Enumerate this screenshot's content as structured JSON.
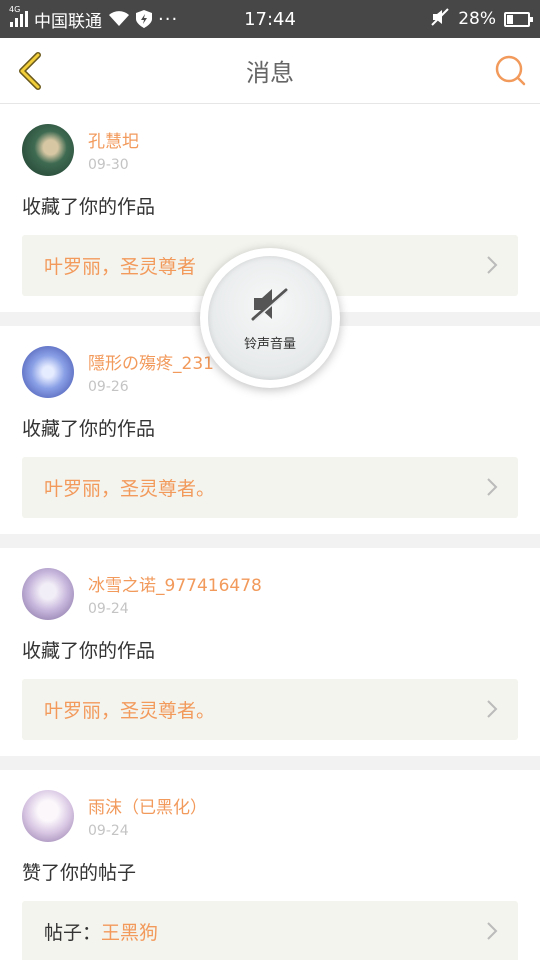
{
  "status_bar": {
    "network_tag": "4G",
    "carrier": "中国联通",
    "dots": "···",
    "time": "17:44",
    "battery_percent_text": "28%",
    "battery_level": 0.28
  },
  "nav": {
    "title": "消息",
    "back_icon": "chevron-left-icon",
    "search_icon": "search-icon",
    "accent_color": "#f29a5c"
  },
  "messages": [
    {
      "name": "孔慧圯",
      "date": "09-30",
      "action": "收藏了你的作品",
      "card_prefix": "",
      "card_text": "叶罗丽，圣灵尊者"
    },
    {
      "name": "隱形の殤疼_231",
      "date": "09-26",
      "action": "收藏了你的作品",
      "card_prefix": "",
      "card_text": "叶罗丽，圣灵尊者。"
    },
    {
      "name": "冰雪之诺_977416478",
      "date": "09-24",
      "action": "收藏了你的作品",
      "card_prefix": "",
      "card_text": "叶罗丽，圣灵尊者。"
    },
    {
      "name": "雨沫（已黑化）",
      "date": "09-24",
      "action": "赞了你的帖子",
      "card_prefix": "帖子：",
      "card_text": "王黑狗"
    }
  ],
  "toast": {
    "label": "铃声音量",
    "icon": "speaker-muted-icon"
  }
}
